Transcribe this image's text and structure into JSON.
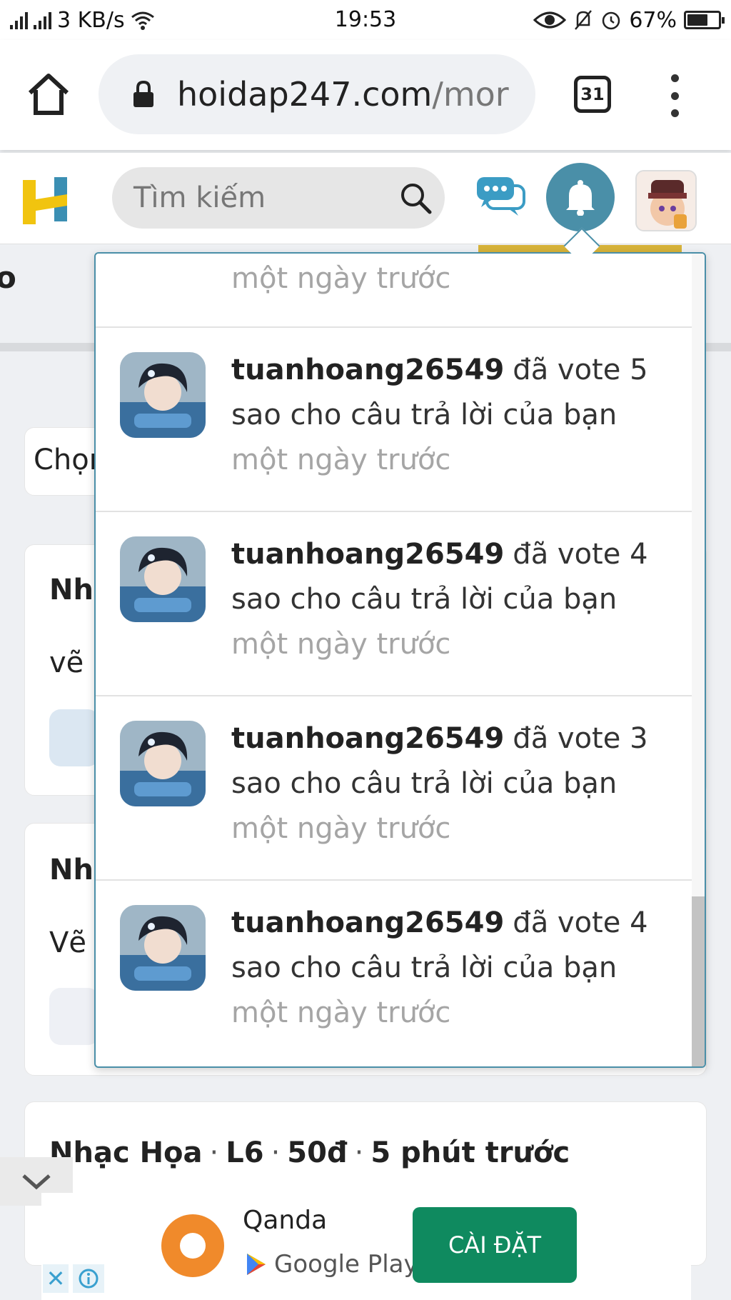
{
  "status_bar": {
    "network_speed": "3 KB/s",
    "time": "19:53",
    "battery": "67%",
    "battery_level": 0.67
  },
  "browser": {
    "url_host": "hoidap247.com",
    "url_path": "/mor",
    "tab_count": "31"
  },
  "site": {
    "search_placeholder": "Tìm kiếm",
    "accent_color": "#4a8fa8"
  },
  "background": {
    "top_fragment": "o",
    "select_fragment": "Chọn",
    "card1_title": "Nh",
    "card1_body": "vẽ a",
    "card2_title": "Nh",
    "card2_body": "Vẽ",
    "card3": {
      "subject": "Nhạc Họa",
      "grade": "L6",
      "points": "50đ",
      "time": "5 phút trước"
    }
  },
  "notifications": {
    "partial_time": "một ngày trước",
    "items": [
      {
        "user": "tuanhoang26549",
        "action": "đã vote 5 sao cho câu trả lời của bạn",
        "time": "một ngày trước"
      },
      {
        "user": "tuanhoang26549",
        "action": "đã vote 4 sao cho câu trả lời của bạn",
        "time": "một ngày trước"
      },
      {
        "user": "tuanhoang26549",
        "action": "đã vote 3 sao cho câu trả lời của bạn",
        "time": "một ngày trước"
      },
      {
        "user": "tuanhoang26549",
        "action": "đã vote 4 sao cho câu trả lời của bạn",
        "time": "một ngày trước"
      }
    ]
  },
  "ad": {
    "app_name": "Qanda",
    "store": "Google Play",
    "cta": "CÀI ĐẶT",
    "close_glyph": "✕"
  }
}
